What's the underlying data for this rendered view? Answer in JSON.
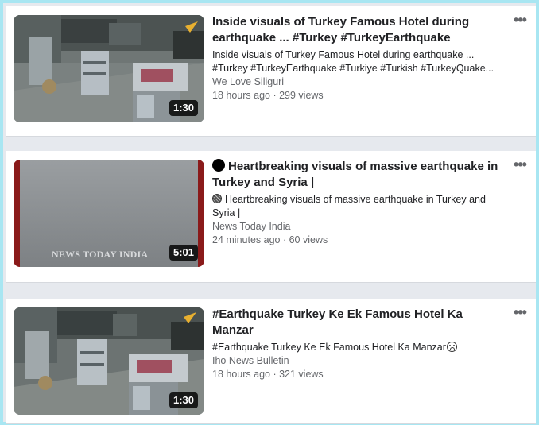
{
  "videos": [
    {
      "title": "Inside visuals of Turkey Famous Hotel during earthquake ... #Turkey #TurkeyEarthquake #Turkiye...",
      "description": "Inside visuals of Turkey Famous Hotel during earthquake ... #Turkey #TurkeyEarthquake #Turkiye #Turkish #TurkeyQuake...",
      "channel": "We Love Siliguri",
      "meta": "18 hours ago · 299 views",
      "duration": "1:30",
      "more_icon": "more-horizontal-icon"
    },
    {
      "title": "Heartbreaking visuals of massive earthquake in Turkey and Syria |",
      "description": "Heartbreaking visuals of massive earthquake in Turkey and Syria |",
      "channel": "News Today India",
      "meta": "24 minutes ago · 60 views",
      "duration": "5:01",
      "watermark": "NEWS TODAY INDIA",
      "more_icon": "more-horizontal-icon"
    },
    {
      "title": "#Earthquake Turkey Ke Ek Famous Hotel Ka Manzar",
      "description": "#Earthquake Turkey Ke Ek Famous Hotel Ka Manzar",
      "channel": "Iho News Bulletin",
      "meta": "18 hours ago · 321 views",
      "duration": "1:30",
      "more_icon": "more-horizontal-icon"
    }
  ],
  "colors": {
    "border": "#a8e6f2",
    "background": "#e6e9ee",
    "card": "#ffffff",
    "secondary_text": "#65676b"
  }
}
